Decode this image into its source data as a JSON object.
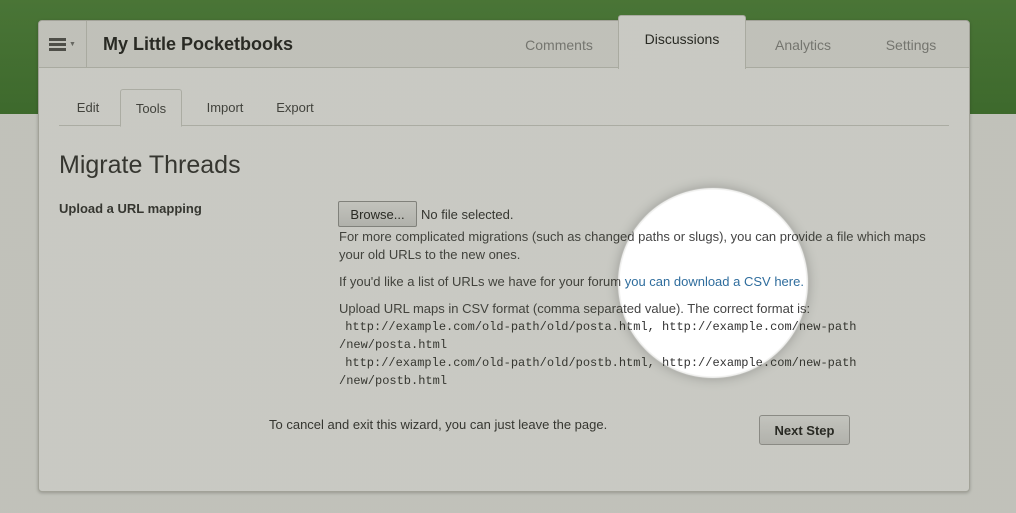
{
  "app": {
    "title": "My Little Pocketbooks"
  },
  "icons": {
    "menu": "hamburger-menu-icon",
    "caret": "caret-down-icon"
  },
  "main_tabs": [
    {
      "label": "Comments",
      "active": false
    },
    {
      "label": "Discussions",
      "active": true
    },
    {
      "label": "Analytics",
      "active": false
    },
    {
      "label": "Settings",
      "active": false
    }
  ],
  "sub_tabs": [
    {
      "label": "Edit",
      "active": false
    },
    {
      "label": "Tools",
      "active": true
    },
    {
      "label": "Import",
      "active": false
    },
    {
      "label": "Export",
      "active": false
    }
  ],
  "page": {
    "title": "Migrate Threads"
  },
  "upload": {
    "label": "Upload a URL mapping",
    "browse_label": "Browse...",
    "file_status": "No file selected.",
    "help_line1": "For more complicated migrations (such as changed paths or slugs), you can provide a file which maps",
    "help_line2": "your old URLs to the new ones.",
    "csv_prefix": "If you'd like a list of URLs we have for your forum ",
    "csv_link": "you can download a CSV here.",
    "format_intro": "Upload URL maps in CSV format (comma separated value). The correct format is:",
    "example_1a": " http://example.com/old-path/old/posta.html, http://example.com/new-path",
    "example_1b": "/new/posta.html",
    "example_2a": " http://example.com/old-path/old/postb.html, http://example.com/new-path",
    "example_2b": "/new/postb.html"
  },
  "footer": {
    "cancel_text": "To cancel and exit this wizard, you can just leave the page.",
    "next_label": "Next Step"
  },
  "colors": {
    "header_green": "#4f8a3c",
    "link": "#2f6d9d",
    "panel_bg": "#ffffff"
  }
}
